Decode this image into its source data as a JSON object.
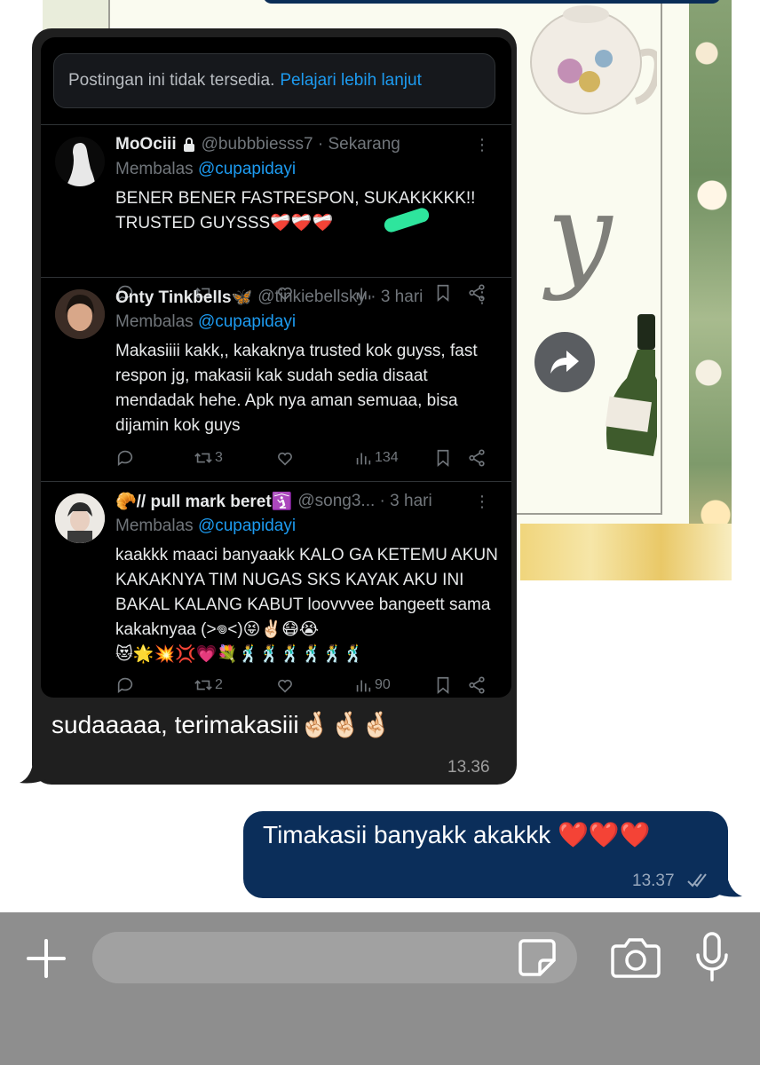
{
  "wallpaper": {
    "script_text": "y"
  },
  "received": {
    "unavailable_text": "Postingan ini tidak tersedia.",
    "unavailable_link": "Pelajari lebih lanjut",
    "tweets": [
      {
        "name": "MoOciii",
        "handle": "@bubbbiesss7 · Sekarang",
        "reply_prefix": "Membalas",
        "mention": "@cupapidayi",
        "body": "BENER BENER FASTRESPON, SUKAKKKKK!!\nTRUSTED GUYSSS❤️‍🩹❤️‍🩹❤️‍🩹",
        "retweets": "",
        "views": ""
      },
      {
        "name": "Onty Tinkbells🦋",
        "handle": "@tinkiebellsky · 3 hari",
        "reply_prefix": "Membalas",
        "mention": "@cupapidayi",
        "body": "Makasiiii kakk,, kakaknya trusted kok guyss, fast respon jg, makasii kak sudah sedia disaat mendadak hehe. Apk nya aman semuaa, bisa dijamin kok guys",
        "retweets": "3",
        "views": "134"
      },
      {
        "name": "🥐// pull mark beret🛐",
        "handle": "@song3... · 3 hari",
        "reply_prefix": "Membalas",
        "mention": "@cupapidayi",
        "body": "kaakkk maaci banyaakk KALO GA KETEMU AKUN KAKAKNYA TIM NUGAS SKS KAYAK AKU INI BAKAL KALANG KABUT loovvvee bangeett sama kakaknyaa (>𖦹<)😝✌🏻😷😭\n😻🌟💥💢💗💐🕺🕺🕺🕺🕺🕺",
        "retweets": "2",
        "views": "90"
      }
    ],
    "caption": "sudaaaaa, terimakasiii🤞🏻🤞🏻🤞🏻",
    "time": "13.36"
  },
  "sent": {
    "text": "Timakasii banyakk akakkk ❤️❤️❤️",
    "time": "13.37"
  },
  "icons": [
    "lock-icon",
    "more-icon",
    "reply-icon",
    "retweet-icon",
    "like-icon",
    "views-icon",
    "bookmark-icon",
    "share-icon",
    "forward-icon",
    "plus-icon",
    "sticker-icon",
    "camera-icon",
    "mic-icon",
    "read-ticks-icon"
  ]
}
